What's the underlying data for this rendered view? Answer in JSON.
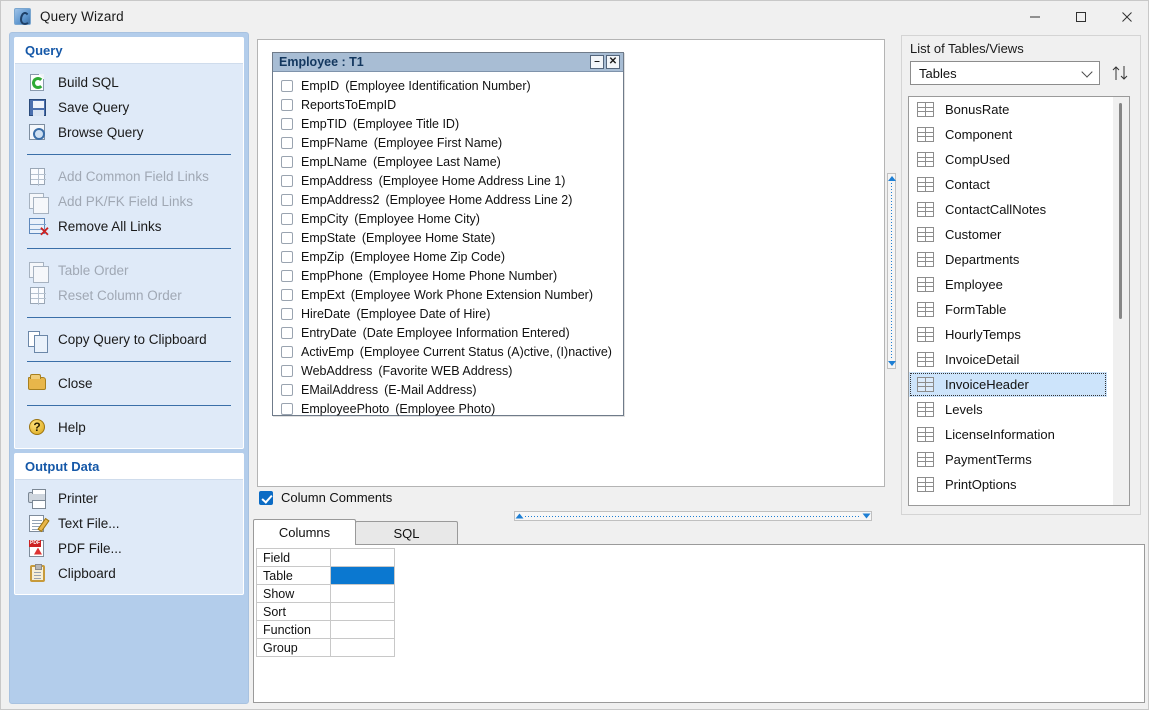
{
  "window": {
    "title": "Query Wizard",
    "icon": "app-icon",
    "controls": {
      "minimize": "–",
      "maximize": "□",
      "close": "✕"
    }
  },
  "sidebar": {
    "groups": [
      {
        "header": "Query",
        "items": [
          {
            "label": "Build SQL",
            "icon": "build-sql-icon",
            "disabled": false
          },
          {
            "label": "Save Query",
            "icon": "save-query-icon",
            "disabled": false
          },
          {
            "label": "Browse Query",
            "icon": "browse-query-icon",
            "disabled": false
          },
          {
            "separator": true
          },
          {
            "label": "Add Common Field Links",
            "icon": "add-common-field-links-icon",
            "disabled": true
          },
          {
            "label": "Add PK/FK Field Links",
            "icon": "add-pkfk-field-links-icon",
            "disabled": true
          },
          {
            "label": "Remove All Links",
            "icon": "remove-all-links-icon",
            "disabled": false
          },
          {
            "separator": true
          },
          {
            "label": "Table Order",
            "icon": "table-order-icon",
            "disabled": true
          },
          {
            "label": "Reset Column Order",
            "icon": "reset-column-order-icon",
            "disabled": true
          },
          {
            "separator": true
          },
          {
            "label": "Copy Query to Clipboard",
            "icon": "copy-query-icon",
            "disabled": false
          },
          {
            "separator": true
          },
          {
            "label": "Close",
            "icon": "close-folder-icon",
            "disabled": false
          },
          {
            "separator": true
          },
          {
            "label": "Help",
            "icon": "help-icon",
            "disabled": false
          }
        ]
      },
      {
        "header": "Output Data",
        "items": [
          {
            "label": "Printer",
            "icon": "printer-icon",
            "disabled": false
          },
          {
            "label": "Text File...",
            "icon": "text-file-icon",
            "disabled": false
          },
          {
            "label": "PDF File...",
            "icon": "pdf-file-icon",
            "disabled": false
          },
          {
            "label": "Clipboard",
            "icon": "clipboard-icon",
            "disabled": false
          }
        ]
      }
    ]
  },
  "design_area": {
    "table_window": {
      "title": "Employee : T1",
      "minimize_label": "–",
      "close_label": "✕",
      "fields": [
        {
          "name": "EmpID",
          "desc": "(Employee Identification Number)",
          "checked": false
        },
        {
          "name": "ReportsToEmpID",
          "desc": "",
          "checked": false
        },
        {
          "name": "EmpTID",
          "desc": "(Employee Title ID)",
          "checked": false
        },
        {
          "name": "EmpFName",
          "desc": "(Employee First Name)",
          "checked": false
        },
        {
          "name": "EmpLName",
          "desc": "(Employee Last Name)",
          "checked": false
        },
        {
          "name": "EmpAddress",
          "desc": "(Employee Home Address Line 1)",
          "checked": false
        },
        {
          "name": "EmpAddress2",
          "desc": "(Employee Home Address Line 2)",
          "checked": false
        },
        {
          "name": "EmpCity",
          "desc": "(Employee Home City)",
          "checked": false
        },
        {
          "name": "EmpState",
          "desc": "(Employee Home State)",
          "checked": false
        },
        {
          "name": "EmpZip",
          "desc": "(Employee Home Zip Code)",
          "checked": false
        },
        {
          "name": "EmpPhone",
          "desc": "(Employee Home Phone Number)",
          "checked": false
        },
        {
          "name": "EmpExt",
          "desc": "(Employee Work Phone Extension Number)",
          "checked": false
        },
        {
          "name": "HireDate",
          "desc": "(Employee Date of Hire)",
          "checked": false
        },
        {
          "name": "EntryDate",
          "desc": "(Date Employee Information Entered)",
          "checked": false
        },
        {
          "name": "ActivEmp",
          "desc": "(Employee Current Status (A)ctive, (I)nactive)",
          "checked": false
        },
        {
          "name": "WebAddress",
          "desc": "(Favorite WEB Address)",
          "checked": false
        },
        {
          "name": "EMailAddress",
          "desc": "(E-Mail Address)",
          "checked": false
        },
        {
          "name": "EmployeePhoto",
          "desc": "(Employee Photo)",
          "checked": false
        }
      ]
    }
  },
  "options": {
    "column_comments_label": "Column Comments",
    "column_comments_checked": true
  },
  "bottom": {
    "tabs": [
      {
        "label": "Columns",
        "active": true
      },
      {
        "label": "SQL",
        "active": false
      }
    ],
    "grid": {
      "row_headers": [
        "Field",
        "Table",
        "Show",
        "Sort",
        "Function",
        "Group"
      ],
      "values": [
        "",
        "",
        "",
        "",
        "",
        ""
      ],
      "selected_row_index": 1,
      "selection_color": "#0b78d0"
    }
  },
  "right_panel": {
    "label": "List of Tables/Views",
    "filter_value": "Tables",
    "sort_button_icon": "sort-arrows-icon",
    "tables": [
      {
        "name": "BonusRate",
        "selected": false
      },
      {
        "name": "Component",
        "selected": false
      },
      {
        "name": "CompUsed",
        "selected": false
      },
      {
        "name": "Contact",
        "selected": false
      },
      {
        "name": "ContactCallNotes",
        "selected": false
      },
      {
        "name": "Customer",
        "selected": false
      },
      {
        "name": "Departments",
        "selected": false
      },
      {
        "name": "Employee",
        "selected": false
      },
      {
        "name": "FormTable",
        "selected": false
      },
      {
        "name": "HourlyTemps",
        "selected": false
      },
      {
        "name": "InvoiceDetail",
        "selected": false
      },
      {
        "name": "InvoiceHeader",
        "selected": true
      },
      {
        "name": "Levels",
        "selected": false
      },
      {
        "name": "LicenseInformation",
        "selected": false
      },
      {
        "name": "PaymentTerms",
        "selected": false
      },
      {
        "name": "PrintOptions",
        "selected": false
      }
    ]
  },
  "colors": {
    "sidebar_bg": "#b3cdeb",
    "group_bg": "#dfeaf8",
    "header_text": "#1558a8",
    "table_title_bg": "#a8bdd4",
    "selection_blue": "#cde4fb",
    "grid_selection": "#0b78d0"
  }
}
